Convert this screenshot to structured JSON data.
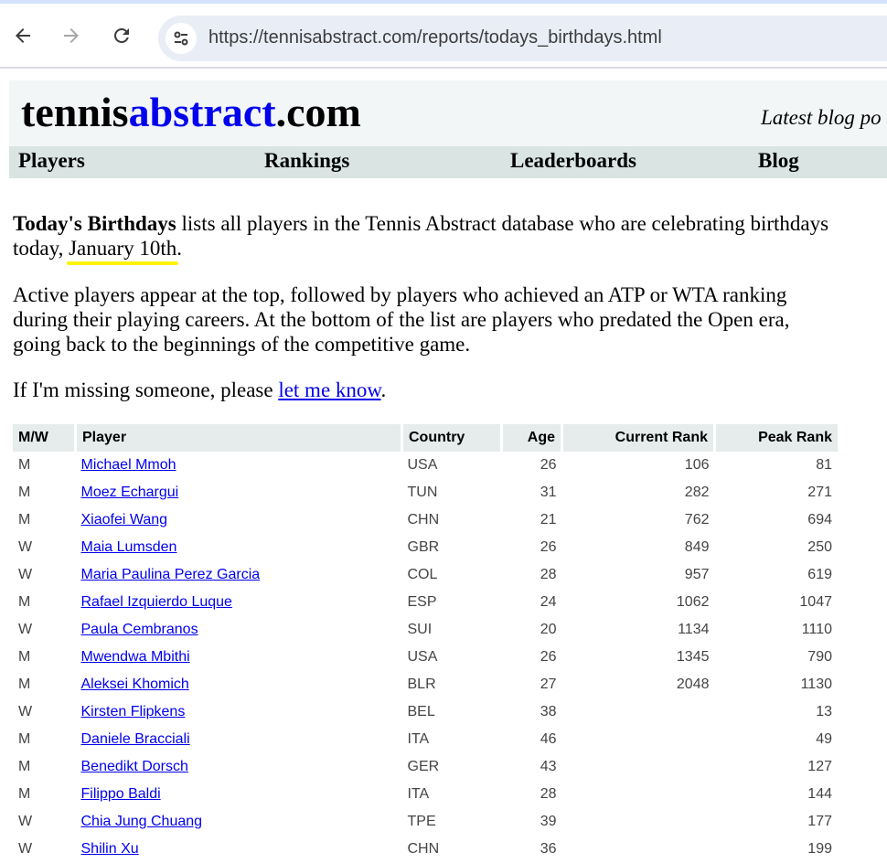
{
  "browser": {
    "url": "https://tennisabstract.com/reports/todays_birthdays.html"
  },
  "site": {
    "logo_part1": "tennis",
    "logo_part2": "abstract",
    "logo_part3": ".com",
    "latest_blog": "Latest blog po",
    "nav": [
      "Players",
      "Rankings",
      "Leaderboards",
      "Blog"
    ]
  },
  "intro": {
    "title": "Today's Birthdays",
    "p1_text": " lists all players in the Tennis Abstract database who are celebrating birthdays today, ",
    "date": "January 10th",
    "p1_end": ".",
    "p2": "Active players appear at the top, followed by players who achieved an ATP or WTA ranking during their playing careers. At the bottom of the list are players who predated the Open era, going back to the beginnings of the competitive game.",
    "p3_start": "If I'm missing someone, please ",
    "p3_link": "let me know",
    "p3_end": "."
  },
  "table": {
    "headers": [
      "M/W",
      "Player",
      "Country",
      "Age",
      "Current Rank",
      "Peak Rank"
    ],
    "rows": [
      {
        "mw": "M",
        "player": "Michael Mmoh",
        "country": "USA",
        "age": "26",
        "current": "106",
        "peak": "81"
      },
      {
        "mw": "M",
        "player": "Moez Echargui",
        "country": "TUN",
        "age": "31",
        "current": "282",
        "peak": "271"
      },
      {
        "mw": "M",
        "player": "Xiaofei Wang",
        "country": "CHN",
        "age": "21",
        "current": "762",
        "peak": "694"
      },
      {
        "mw": "W",
        "player": "Maia Lumsden",
        "country": "GBR",
        "age": "26",
        "current": "849",
        "peak": "250"
      },
      {
        "mw": "W",
        "player": "Maria Paulina Perez Garcia",
        "country": "COL",
        "age": "28",
        "current": "957",
        "peak": "619"
      },
      {
        "mw": "M",
        "player": "Rafael Izquierdo Luque",
        "country": "ESP",
        "age": "24",
        "current": "1062",
        "peak": "1047"
      },
      {
        "mw": "W",
        "player": "Paula Cembranos",
        "country": "SUI",
        "age": "20",
        "current": "1134",
        "peak": "1110"
      },
      {
        "mw": "M",
        "player": "Mwendwa Mbithi",
        "country": "USA",
        "age": "26",
        "current": "1345",
        "peak": "790"
      },
      {
        "mw": "M",
        "player": "Aleksei Khomich",
        "country": "BLR",
        "age": "27",
        "current": "2048",
        "peak": "1130"
      },
      {
        "mw": "W",
        "player": "Kirsten Flipkens",
        "country": "BEL",
        "age": "38",
        "current": "",
        "peak": "13"
      },
      {
        "mw": "M",
        "player": "Daniele Bracciali",
        "country": "ITA",
        "age": "46",
        "current": "",
        "peak": "49"
      },
      {
        "mw": "M",
        "player": "Benedikt Dorsch",
        "country": "GER",
        "age": "43",
        "current": "",
        "peak": "127"
      },
      {
        "mw": "M",
        "player": "Filippo Baldi",
        "country": "ITA",
        "age": "28",
        "current": "",
        "peak": "144"
      },
      {
        "mw": "W",
        "player": "Chia Jung Chuang",
        "country": "TPE",
        "age": "39",
        "current": "",
        "peak": "177"
      },
      {
        "mw": "W",
        "player": "Shilin Xu",
        "country": "CHN",
        "age": "36",
        "current": "",
        "peak": "199"
      }
    ]
  }
}
